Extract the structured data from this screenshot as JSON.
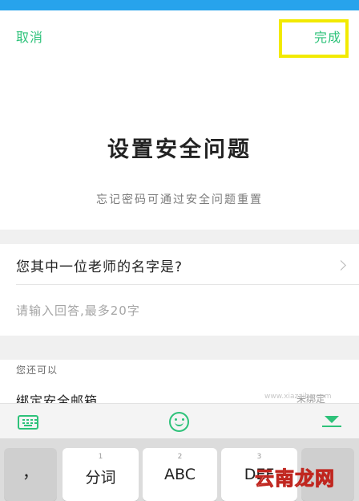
{
  "colors": {
    "status_strip": "#27a3ec",
    "accent_green": "#2ec27a",
    "highlight_box": "#f2ea00",
    "watermark_red": "#c0261f"
  },
  "nav": {
    "cancel_label": "取消",
    "done_label": "完成"
  },
  "header": {
    "title": "设置安全问题",
    "subtitle": "忘记密码可通过安全问题重置"
  },
  "question": {
    "text": "您其中一位老师的名字是?",
    "icon": "chevron-right-icon"
  },
  "answer": {
    "value": "",
    "placeholder": "请输入回答,最多20字"
  },
  "more": {
    "section_label": "您还可以",
    "bind_label": "绑定安全邮箱",
    "bind_status": "未绑定"
  },
  "keyboard": {
    "toolbar_icons": [
      "keyboard-switch-icon",
      "smile-icon",
      "collapse-keyboard-icon"
    ],
    "keys": [
      {
        "num": "",
        "label": "，"
      },
      {
        "num": "1",
        "label": "分词"
      },
      {
        "num": "2",
        "label": "ABC"
      },
      {
        "num": "3",
        "label": "DEF"
      },
      {
        "num": "",
        "label": ""
      }
    ]
  },
  "watermark": {
    "brand": "云南龙网",
    "url": "www.xiazaiba.com"
  }
}
